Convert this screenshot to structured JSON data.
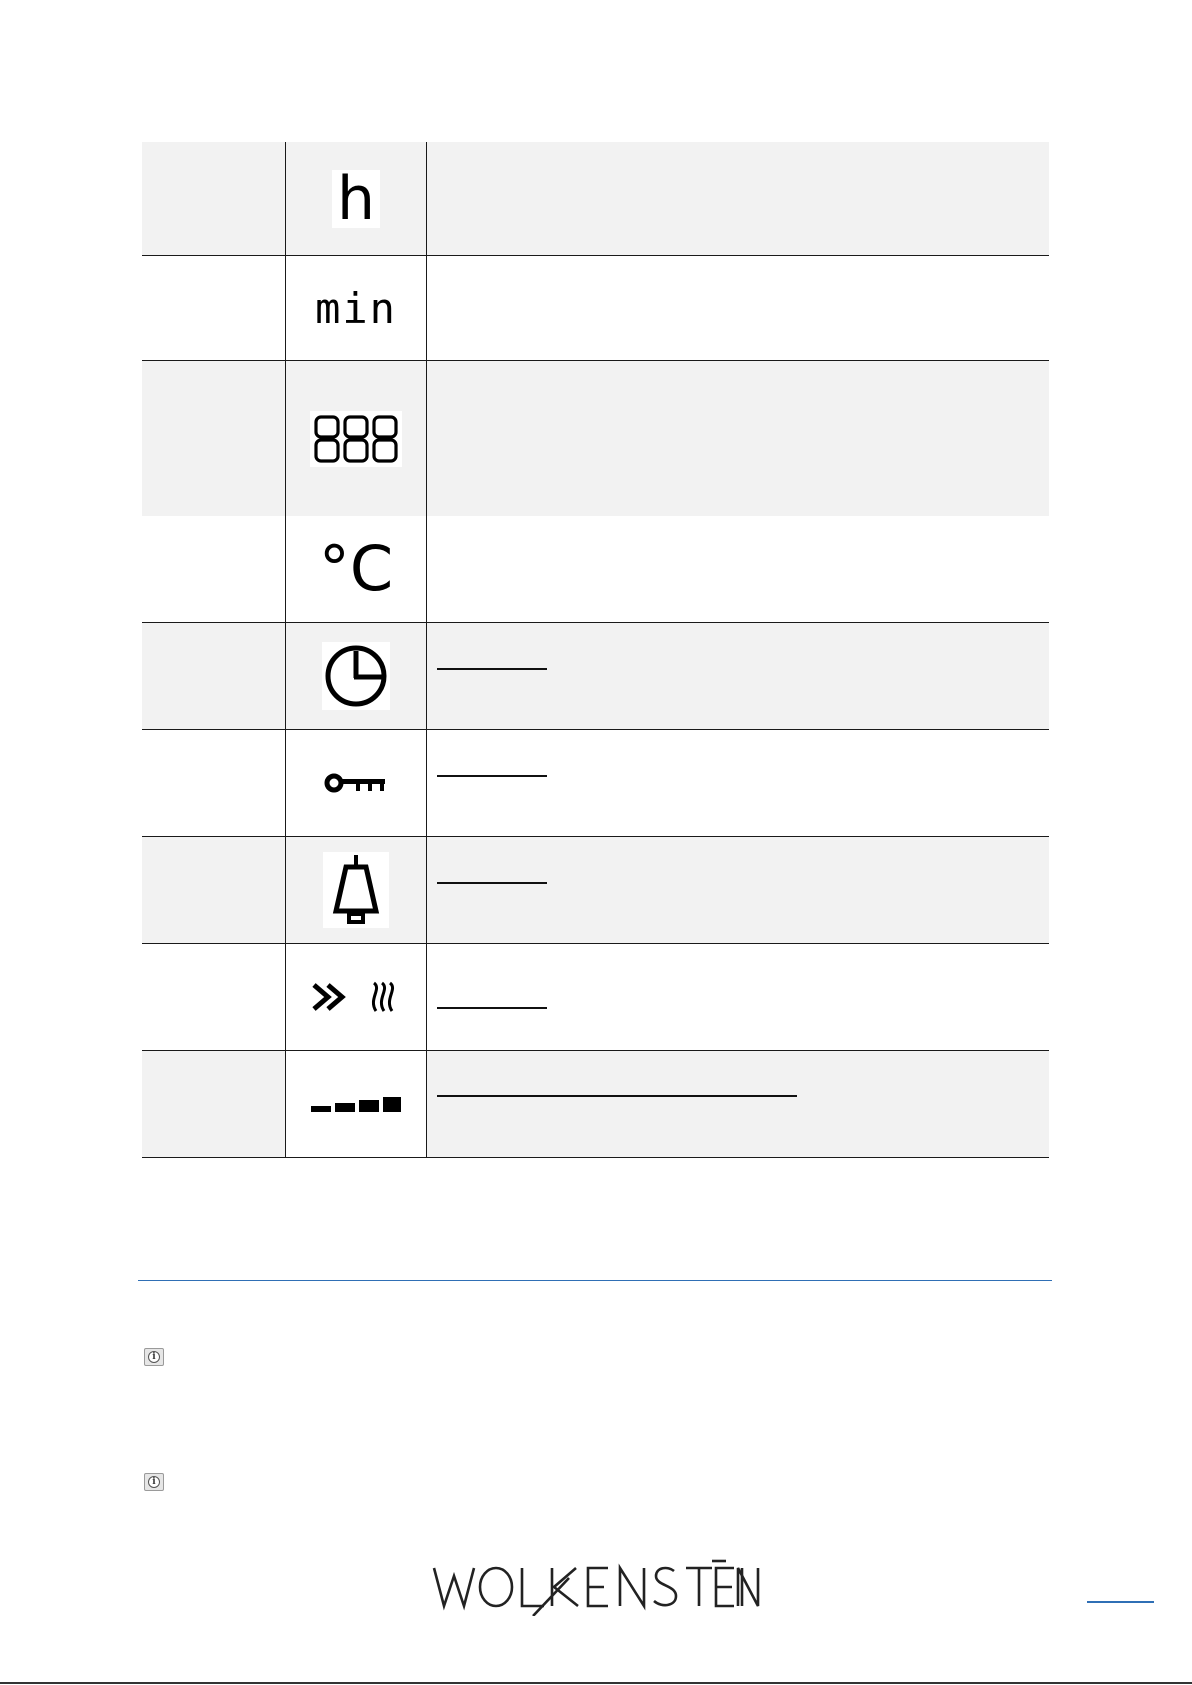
{
  "symbol_table": {
    "rows": [
      {
        "icon": "hour-symbol-icon",
        "glyph": "h"
      },
      {
        "icon": "minute-symbol-icon",
        "glyph": "min"
      },
      {
        "icon": "seven-segment-display-icon",
        "glyph": "888"
      },
      {
        "icon": "celsius-symbol-icon",
        "glyph": "°C"
      },
      {
        "icon": "clock-timer-icon"
      },
      {
        "icon": "key-lock-icon"
      },
      {
        "icon": "bell-alarm-icon"
      },
      {
        "icon": "fast-heating-icon"
      },
      {
        "icon": "power-level-bars-icon"
      }
    ]
  },
  "notes": [
    {
      "icon": "info-icon"
    },
    {
      "icon": "info-icon"
    }
  ],
  "footer": {
    "logo_text": "WOLKENSTEIN",
    "accent_color": "#2f6fb5"
  }
}
